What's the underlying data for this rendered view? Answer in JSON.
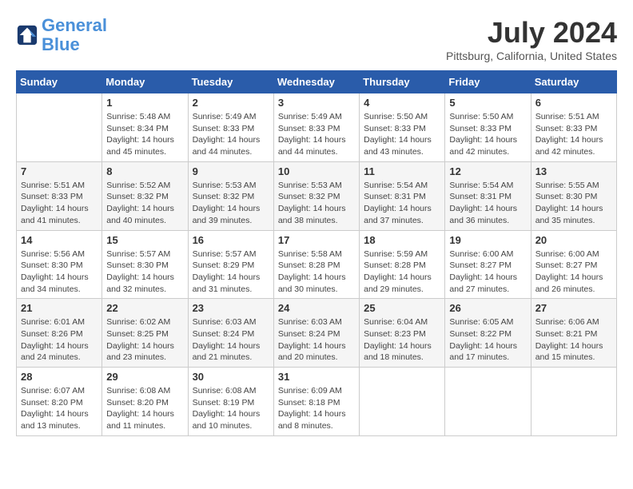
{
  "header": {
    "logo_line1": "General",
    "logo_line2": "Blue",
    "month_year": "July 2024",
    "location": "Pittsburg, California, United States"
  },
  "days_of_week": [
    "Sunday",
    "Monday",
    "Tuesday",
    "Wednesday",
    "Thursday",
    "Friday",
    "Saturday"
  ],
  "weeks": [
    [
      {
        "day": "",
        "info": ""
      },
      {
        "day": "1",
        "info": "Sunrise: 5:48 AM\nSunset: 8:34 PM\nDaylight: 14 hours\nand 45 minutes."
      },
      {
        "day": "2",
        "info": "Sunrise: 5:49 AM\nSunset: 8:33 PM\nDaylight: 14 hours\nand 44 minutes."
      },
      {
        "day": "3",
        "info": "Sunrise: 5:49 AM\nSunset: 8:33 PM\nDaylight: 14 hours\nand 44 minutes."
      },
      {
        "day": "4",
        "info": "Sunrise: 5:50 AM\nSunset: 8:33 PM\nDaylight: 14 hours\nand 43 minutes."
      },
      {
        "day": "5",
        "info": "Sunrise: 5:50 AM\nSunset: 8:33 PM\nDaylight: 14 hours\nand 42 minutes."
      },
      {
        "day": "6",
        "info": "Sunrise: 5:51 AM\nSunset: 8:33 PM\nDaylight: 14 hours\nand 42 minutes."
      }
    ],
    [
      {
        "day": "7",
        "info": "Sunrise: 5:51 AM\nSunset: 8:33 PM\nDaylight: 14 hours\nand 41 minutes."
      },
      {
        "day": "8",
        "info": "Sunrise: 5:52 AM\nSunset: 8:32 PM\nDaylight: 14 hours\nand 40 minutes."
      },
      {
        "day": "9",
        "info": "Sunrise: 5:53 AM\nSunset: 8:32 PM\nDaylight: 14 hours\nand 39 minutes."
      },
      {
        "day": "10",
        "info": "Sunrise: 5:53 AM\nSunset: 8:32 PM\nDaylight: 14 hours\nand 38 minutes."
      },
      {
        "day": "11",
        "info": "Sunrise: 5:54 AM\nSunset: 8:31 PM\nDaylight: 14 hours\nand 37 minutes."
      },
      {
        "day": "12",
        "info": "Sunrise: 5:54 AM\nSunset: 8:31 PM\nDaylight: 14 hours\nand 36 minutes."
      },
      {
        "day": "13",
        "info": "Sunrise: 5:55 AM\nSunset: 8:30 PM\nDaylight: 14 hours\nand 35 minutes."
      }
    ],
    [
      {
        "day": "14",
        "info": "Sunrise: 5:56 AM\nSunset: 8:30 PM\nDaylight: 14 hours\nand 34 minutes."
      },
      {
        "day": "15",
        "info": "Sunrise: 5:57 AM\nSunset: 8:30 PM\nDaylight: 14 hours\nand 32 minutes."
      },
      {
        "day": "16",
        "info": "Sunrise: 5:57 AM\nSunset: 8:29 PM\nDaylight: 14 hours\nand 31 minutes."
      },
      {
        "day": "17",
        "info": "Sunrise: 5:58 AM\nSunset: 8:28 PM\nDaylight: 14 hours\nand 30 minutes."
      },
      {
        "day": "18",
        "info": "Sunrise: 5:59 AM\nSunset: 8:28 PM\nDaylight: 14 hours\nand 29 minutes."
      },
      {
        "day": "19",
        "info": "Sunrise: 6:00 AM\nSunset: 8:27 PM\nDaylight: 14 hours\nand 27 minutes."
      },
      {
        "day": "20",
        "info": "Sunrise: 6:00 AM\nSunset: 8:27 PM\nDaylight: 14 hours\nand 26 minutes."
      }
    ],
    [
      {
        "day": "21",
        "info": "Sunrise: 6:01 AM\nSunset: 8:26 PM\nDaylight: 14 hours\nand 24 minutes."
      },
      {
        "day": "22",
        "info": "Sunrise: 6:02 AM\nSunset: 8:25 PM\nDaylight: 14 hours\nand 23 minutes."
      },
      {
        "day": "23",
        "info": "Sunrise: 6:03 AM\nSunset: 8:24 PM\nDaylight: 14 hours\nand 21 minutes."
      },
      {
        "day": "24",
        "info": "Sunrise: 6:03 AM\nSunset: 8:24 PM\nDaylight: 14 hours\nand 20 minutes."
      },
      {
        "day": "25",
        "info": "Sunrise: 6:04 AM\nSunset: 8:23 PM\nDaylight: 14 hours\nand 18 minutes."
      },
      {
        "day": "26",
        "info": "Sunrise: 6:05 AM\nSunset: 8:22 PM\nDaylight: 14 hours\nand 17 minutes."
      },
      {
        "day": "27",
        "info": "Sunrise: 6:06 AM\nSunset: 8:21 PM\nDaylight: 14 hours\nand 15 minutes."
      }
    ],
    [
      {
        "day": "28",
        "info": "Sunrise: 6:07 AM\nSunset: 8:20 PM\nDaylight: 14 hours\nand 13 minutes."
      },
      {
        "day": "29",
        "info": "Sunrise: 6:08 AM\nSunset: 8:20 PM\nDaylight: 14 hours\nand 11 minutes."
      },
      {
        "day": "30",
        "info": "Sunrise: 6:08 AM\nSunset: 8:19 PM\nDaylight: 14 hours\nand 10 minutes."
      },
      {
        "day": "31",
        "info": "Sunrise: 6:09 AM\nSunset: 8:18 PM\nDaylight: 14 hours\nand 8 minutes."
      },
      {
        "day": "",
        "info": ""
      },
      {
        "day": "",
        "info": ""
      },
      {
        "day": "",
        "info": ""
      }
    ]
  ]
}
